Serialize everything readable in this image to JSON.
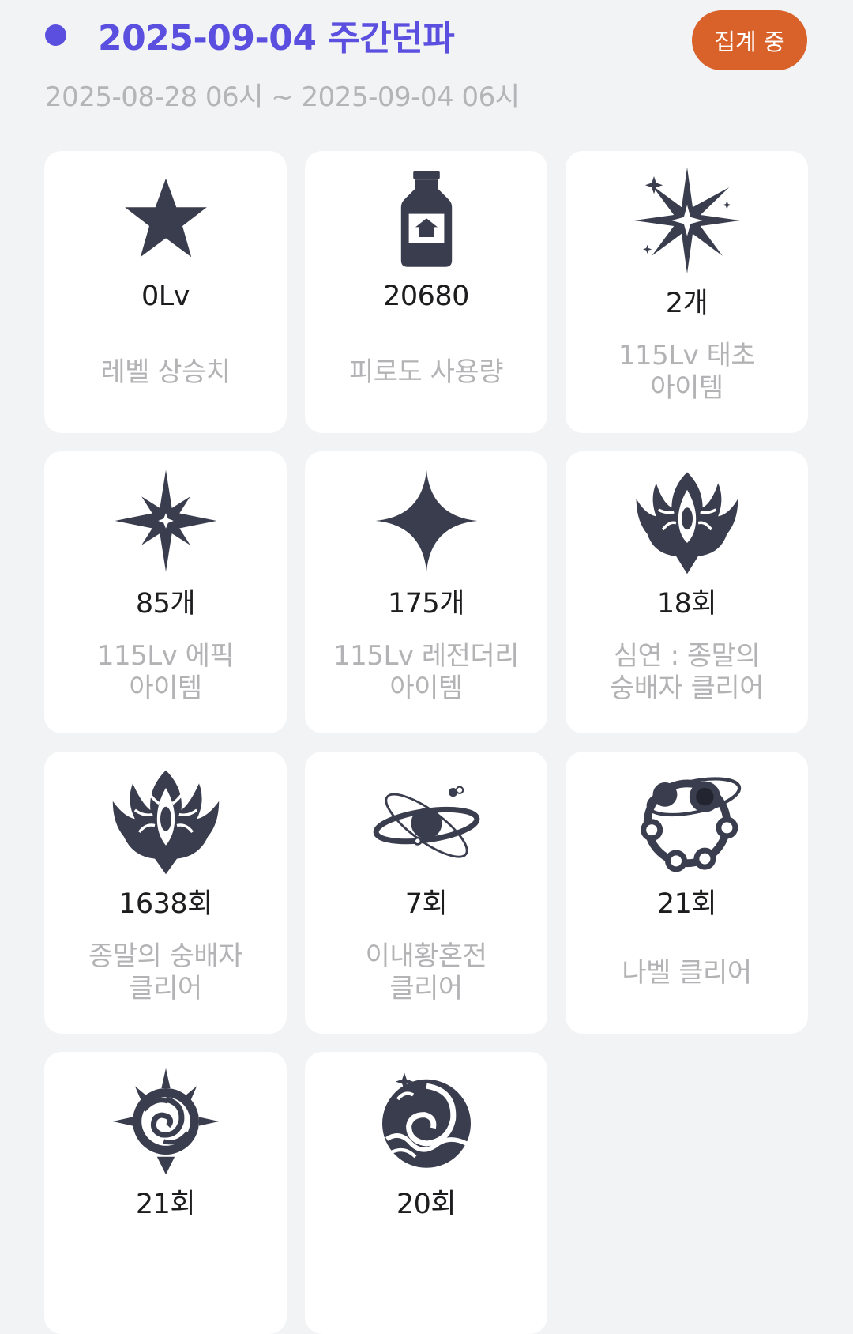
{
  "header": {
    "title": "2025-09-04 주간던파",
    "period": "2025-08-28 06시 ~ 2025-09-04 06시",
    "status_label": "집계 중",
    "accent_color": "#5b4fe0",
    "status_color": "#d9622b"
  },
  "cards": [
    {
      "icon": "star-icon",
      "value": "0Lv",
      "label": "레벨 상승치"
    },
    {
      "icon": "potion-bottle-icon",
      "value": "20680",
      "label": "피로도 사용량"
    },
    {
      "icon": "starburst-icon",
      "value": "2개",
      "label": "115Lv 태초\n아이템"
    },
    {
      "icon": "epic-sparkle-icon",
      "value": "85개",
      "label": "115Lv 에픽\n아이템"
    },
    {
      "icon": "legendary-sparkle-icon",
      "value": "175개",
      "label": "115Lv 레전더리\n아이템"
    },
    {
      "icon": "abyss-crest-icon",
      "value": "18회",
      "label": "심연 : 종말의\n숭배자 클리어"
    },
    {
      "icon": "crest-icon",
      "value": "1638회",
      "label": "종말의 숭배자\n클리어"
    },
    {
      "icon": "planet-orbit-icon",
      "value": "7회",
      "label": "이내황혼전\n클리어"
    },
    {
      "icon": "planet-ring-icon",
      "value": "21회",
      "label": "나벨 클리어"
    },
    {
      "icon": "rose-emblem-icon",
      "value": "21회",
      "label": ""
    },
    {
      "icon": "wave-emblem-icon",
      "value": "20회",
      "label": ""
    }
  ]
}
